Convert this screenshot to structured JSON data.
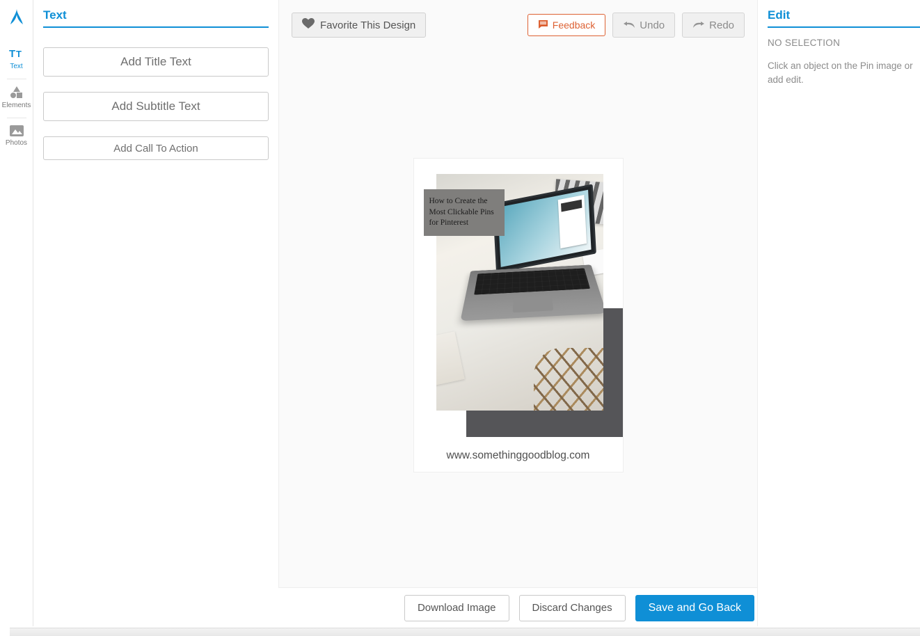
{
  "rail": {
    "items": [
      {
        "label": "Text"
      },
      {
        "label": "Elements"
      },
      {
        "label": "Photos"
      }
    ]
  },
  "leftPanel": {
    "title": "Text",
    "buttons": {
      "title": "Add Title Text",
      "subtitle": "Add Subtitle Text",
      "cta": "Add Call To Action"
    }
  },
  "toolbar": {
    "favorite": "Favorite This Design",
    "feedback": "Feedback",
    "undo": "Undo",
    "redo": "Redo"
  },
  "pin": {
    "caption": "How to Create the Most Clickable Pins for Pinterest",
    "url": "www.somethinggoodblog.com"
  },
  "bottomBar": {
    "download": "Download Image",
    "discard": "Discard Changes",
    "save": "Save and Go Back"
  },
  "rightPanel": {
    "title": "Edit",
    "noSelection": "NO SELECTION",
    "help": "Click an object on the Pin image or add edit."
  },
  "colors": {
    "accent": "#0f8fd6",
    "feedback": "#dd6133"
  }
}
